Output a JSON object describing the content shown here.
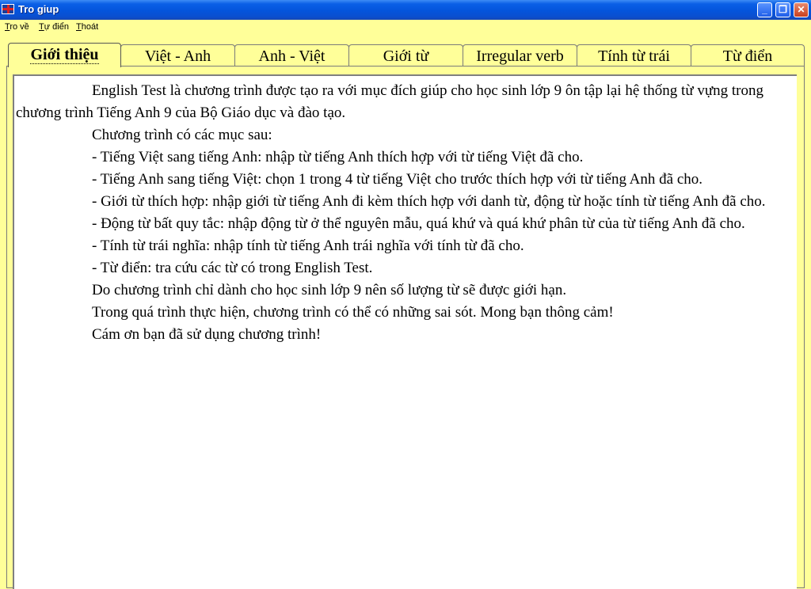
{
  "window": {
    "title": "Tro giup",
    "controls": {
      "minimize": "_",
      "maximize": "❐",
      "close": "✕"
    }
  },
  "menu": [
    {
      "first": "T",
      "rest": "ro về"
    },
    {
      "first": "T",
      "rest": "ự điển"
    },
    {
      "first": "T",
      "rest": "hoát"
    }
  ],
  "tabs": [
    {
      "label": "Giới thiệu",
      "active": true
    },
    {
      "label": "Việt - Anh",
      "active": false
    },
    {
      "label": "Anh - Việt",
      "active": false
    },
    {
      "label": "Giới từ",
      "active": false
    },
    {
      "label": "Irregular verb",
      "active": false
    },
    {
      "label": "Tính từ trái",
      "active": false
    },
    {
      "label": "Từ điển",
      "active": false
    }
  ],
  "content": {
    "paragraphs": [
      "English Test là chương trình được tạo ra với mục đích giúp cho học sinh lớp 9 ôn tập lại hệ thống từ vựng trong chương trình Tiếng Anh 9 của Bộ Giáo dục và đào tạo.",
      "Chương trình có các mục sau:",
      "- Tiếng Việt sang tiếng Anh: nhập từ tiếng Anh thích hợp với từ tiếng Việt đã cho.",
      "- Tiếng Anh sang tiếng Việt: chọn 1 trong 4 từ tiếng Việt cho trước thích hợp với từ tiếng Anh đã cho.",
      "- Giới từ thích hợp: nhập giới từ tiếng Anh đi kèm thích hợp với danh từ, động từ hoặc tính từ tiếng Anh đã cho.",
      "- Động từ bất quy tắc: nhập động từ ở thể nguyên mẫu, quá khứ và quá khứ phân từ của từ tiếng Anh đã cho.",
      "- Tính từ trái nghĩa: nhập tính từ tiếng Anh trái nghĩa với tính từ đã cho.",
      "- Từ điển: tra cứu các từ có trong English Test.",
      "Do chương trình chỉ dành cho học sinh lớp 9 nên số lượng từ sẽ được giới hạn.",
      "Trong quá trình thực hiện, chương trình có thể có những sai sót. Mong bạn thông cảm!",
      "Cám ơn bạn đã sử dụng chương trình!"
    ]
  }
}
